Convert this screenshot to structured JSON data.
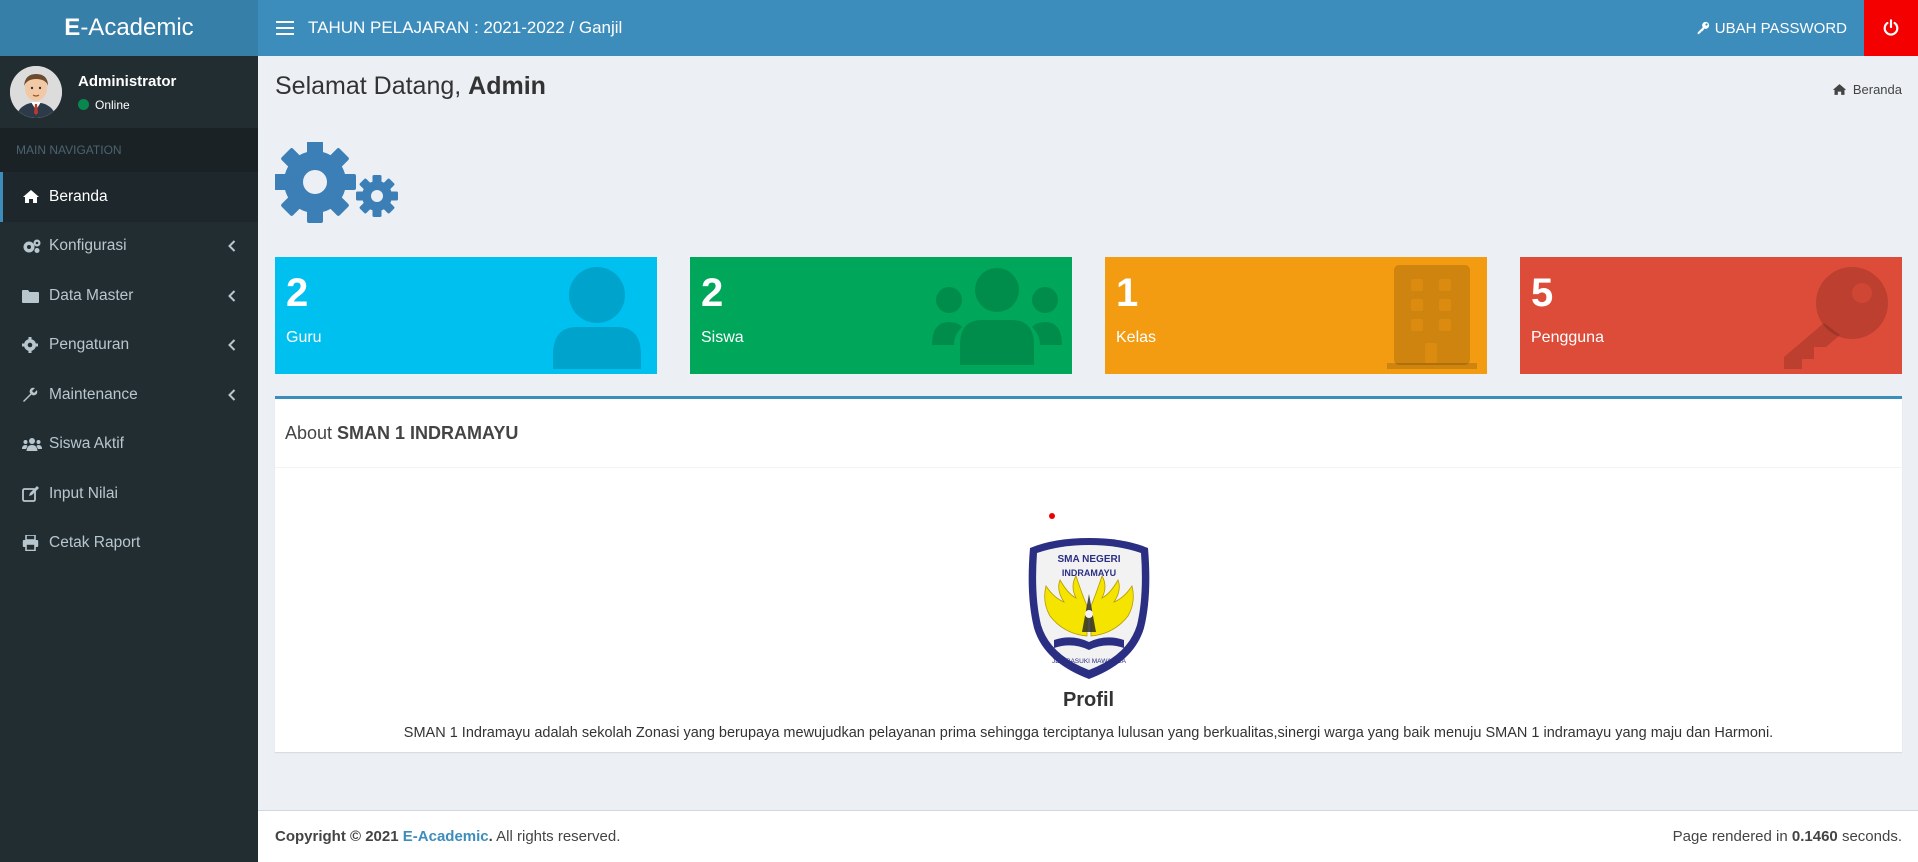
{
  "header": {
    "logo_prefix": "E",
    "logo_suffix": "-Academic",
    "title": "TAHUN PELAJARAN : 2021-2022 / Ganjil",
    "change_password": "UBAH PASSWORD",
    "power_icon": "power-icon"
  },
  "sidebar": {
    "user": {
      "name": "Administrator",
      "status": "Online"
    },
    "nav_header": "MAIN NAVIGATION",
    "items": [
      {
        "label": "Beranda",
        "icon": "home-icon",
        "active": true,
        "has_children": false
      },
      {
        "label": "Konfigurasi",
        "icon": "cogs-icon",
        "active": false,
        "has_children": true
      },
      {
        "label": "Data Master",
        "icon": "folder-icon",
        "active": false,
        "has_children": true
      },
      {
        "label": "Pengaturan",
        "icon": "gear-icon",
        "active": false,
        "has_children": true
      },
      {
        "label": "Maintenance",
        "icon": "wrench-icon",
        "active": false,
        "has_children": true
      },
      {
        "label": "Siswa Aktif",
        "icon": "users-icon",
        "active": false,
        "has_children": false
      },
      {
        "label": "Input Nilai",
        "icon": "edit-icon",
        "active": false,
        "has_children": false
      },
      {
        "label": "Cetak Raport",
        "icon": "print-icon",
        "active": false,
        "has_children": false
      }
    ]
  },
  "main": {
    "welcome_prefix": "Selamat Datang,",
    "welcome_name": "Admin",
    "breadcrumb": "Beranda",
    "stats": [
      {
        "value": "2",
        "label": "Guru",
        "color": "#00c0ef",
        "icon": "user-icon"
      },
      {
        "value": "2",
        "label": "Siswa",
        "color": "#00a65a",
        "icon": "users-icon"
      },
      {
        "value": "1",
        "label": "Kelas",
        "color": "#f39c12",
        "icon": "building-icon"
      },
      {
        "value": "5",
        "label": "Pengguna",
        "color": "#dd4b39",
        "icon": "key-icon"
      }
    ],
    "about": {
      "prefix": "About",
      "school": "SMAN 1 INDRAMAYU",
      "emblem_text_top": "SMA NEGERI",
      "emblem_text_mid": "INDRAMAYU",
      "emblem_motto": "JER BASUKI MAWA BEA",
      "profil_title": "Profil",
      "profil_text": "SMAN 1 Indramayu adalah sekolah Zonasi yang berupaya mewujudkan pelayanan prima sehingga terciptanya lulusan yang berkualitas,sinergi warga yang baik menuju SMAN 1 indramayu yang maju dan Harmoni."
    }
  },
  "footer": {
    "copyright": "Copyright © 2021",
    "brand": "E-Academic",
    "rights": ". All rights reserved.",
    "rendered_prefix": "Page rendered in",
    "rendered_time": "0.1460",
    "rendered_suffix": "seconds."
  },
  "colors": {
    "primary": "#3c8dbc",
    "primary_dark": "#367fa9",
    "sidebar_bg": "#222d32",
    "power": "#f40000"
  }
}
